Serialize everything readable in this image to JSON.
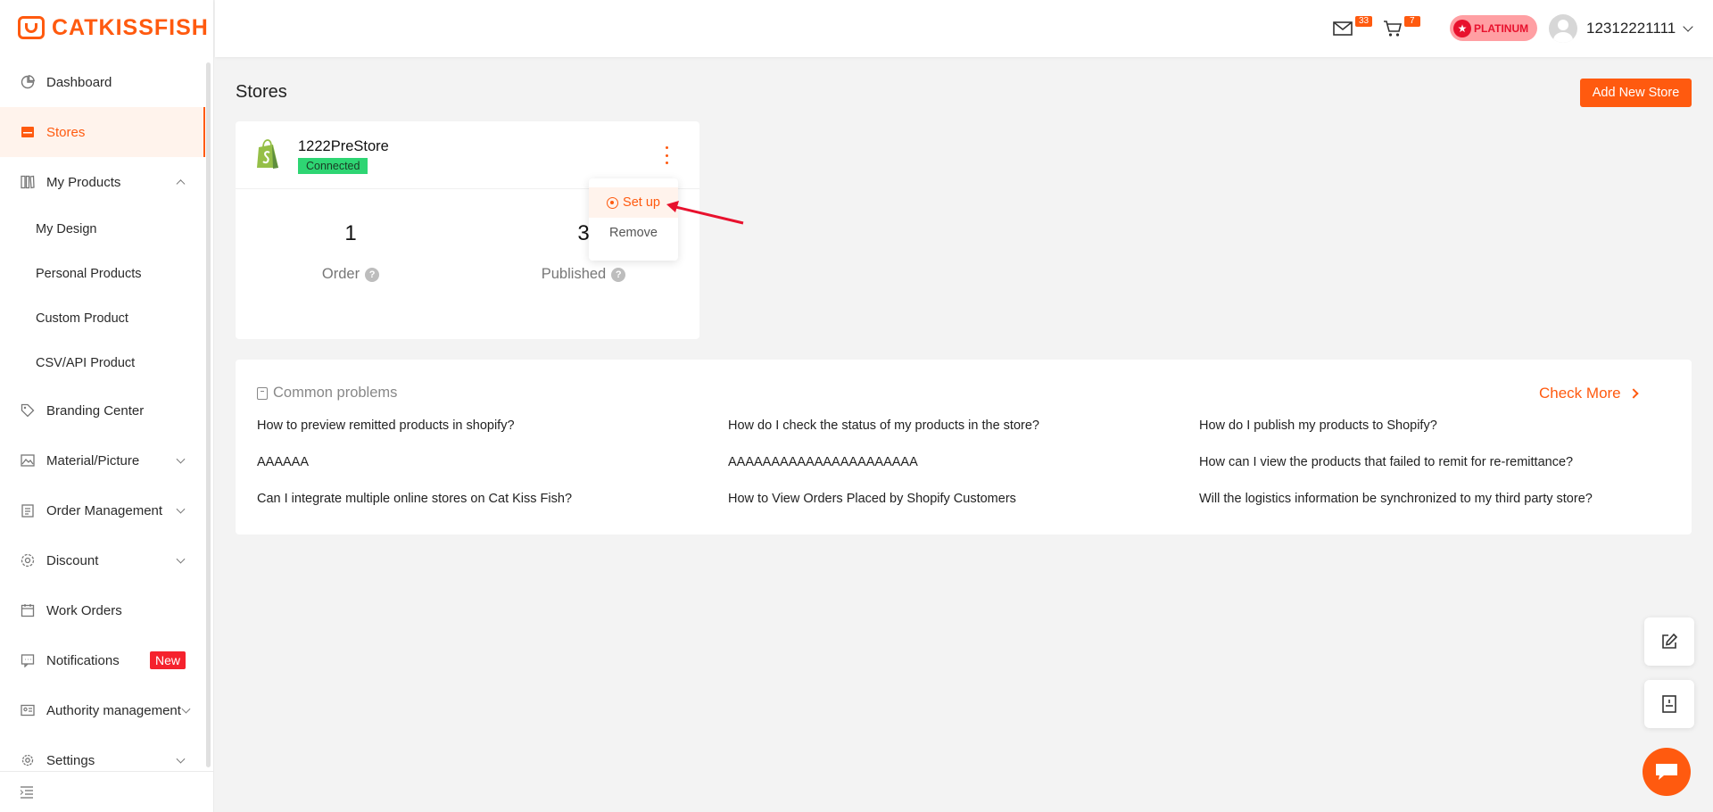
{
  "brand": {
    "name": "CATKISSFISH",
    "accent": "#ff5a0f"
  },
  "header": {
    "mail_count": "33",
    "cart_count": "7",
    "membership": "PLATINUM",
    "username": "12312221111"
  },
  "sidebar": {
    "items": [
      {
        "label": "Dashboard",
        "icon": "dashboard-icon"
      },
      {
        "label": "Stores",
        "icon": "store-icon",
        "active": true
      },
      {
        "label": "My Products",
        "icon": "products-icon",
        "expanded": true
      },
      {
        "label": "Branding Center",
        "icon": "tag-icon"
      },
      {
        "label": "Material/Picture",
        "icon": "image-icon"
      },
      {
        "label": "Order Management",
        "icon": "clipboard-icon"
      },
      {
        "label": "Discount",
        "icon": "discount-icon"
      },
      {
        "label": "Work Orders",
        "icon": "calendar-icon"
      },
      {
        "label": "Notifications",
        "icon": "message-icon",
        "badge": "New"
      },
      {
        "label": "Authority management",
        "icon": "id-card-icon"
      },
      {
        "label": "Settings",
        "icon": "gear-icon"
      }
    ],
    "sub_items": [
      "My Design",
      "Personal Products",
      "Custom Product",
      "CSV/API Product"
    ]
  },
  "main": {
    "title": "Stores",
    "add_button": "Add New Store",
    "store": {
      "name": "1222PreStore",
      "status": "Connected",
      "order_value": "1",
      "order_label": "Order",
      "published_value": "3",
      "published_label": "Published"
    },
    "menu": {
      "setup": "Set up",
      "remove": "Remove"
    },
    "problems": {
      "title": "Common problems",
      "check_more": "Check More",
      "questions": [
        "How to preview remitted products in shopify?",
        "How do I check the status of my products in the store?",
        "How do I publish my products to Shopify?",
        "AAAAAA",
        "AAAAAAAAAAAAAAAAAAAAAA",
        "How can I view the products that failed to remit for re-remittance?",
        "Can I integrate multiple online stores on Cat Kiss Fish?",
        "How to View Orders Placed by Shopify Customers",
        "Will the logistics information be synchronized to my third party store?"
      ]
    }
  }
}
